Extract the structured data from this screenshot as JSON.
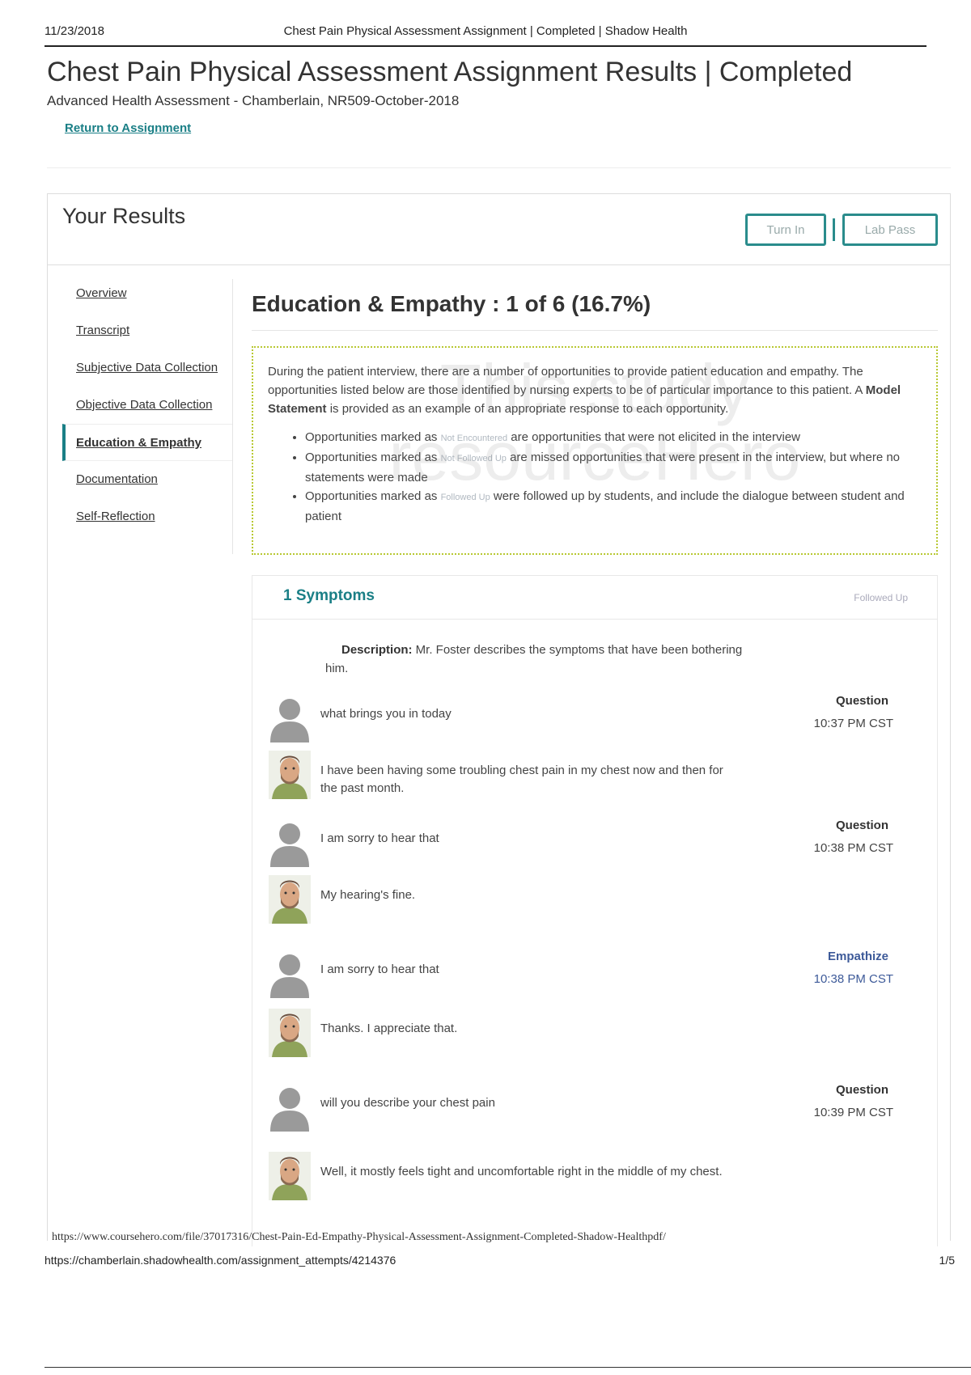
{
  "print_header": {
    "date": "11/23/2018",
    "title": "Chest Pain Physical Assessment Assignment | Completed | Shadow Health"
  },
  "page": {
    "title": "Chest Pain Physical Assessment Assignment Results | Completed",
    "course": "Advanced Health Assessment - Chamberlain, NR509-October-2018",
    "return_link": "Return to Assignment"
  },
  "results": {
    "heading": "Your Results",
    "turn_in_label": "Turn In",
    "lab_pass_label": "Lab Pass"
  },
  "sidebar": {
    "items": [
      {
        "label": "Overview"
      },
      {
        "label": "Transcript"
      },
      {
        "label": "Subjective Data Collection"
      },
      {
        "label": "Objective Data Collection"
      },
      {
        "label": "Education & Empathy"
      },
      {
        "label": "Documentation"
      },
      {
        "label": "Self-Reflection"
      }
    ],
    "active_index": 4
  },
  "section": {
    "title": "Education & Empathy : 1 of 6 (16.7%)",
    "intro_pre": "During the patient interview, there are a number of opportunities to provide patient education and empathy. The opportunities listed below are those identified by nursing experts to be of particular importance to this patient. A ",
    "intro_bold": "Model Statement",
    "intro_post": " is provided as an example of an appropriate response to each opportunity.",
    "bullets": [
      {
        "pre": "Opportunities marked as ",
        "tag": "Not Encountered",
        "post": " are opportunities that were not elicited in the interview"
      },
      {
        "pre": "Opportunities marked as ",
        "tag": "Not Followed Up",
        "post": " are missed opportunities that were present in the interview, but where no statements were made"
      },
      {
        "pre": "Opportunities marked as ",
        "tag": "Followed Up",
        "post": " were followed up by students, and include the dialogue between student and patient"
      }
    ],
    "watermark_line1": "This study",
    "watermark_line2": "resourceHero"
  },
  "symptom": {
    "name": "1 Symptoms",
    "status": "Followed Up",
    "desc_label": "Description:",
    "desc_text": " Mr. Foster describes the symptoms that have been bothering him."
  },
  "messages": [
    {
      "speaker": "student",
      "text": "what brings you in today",
      "type": "Question",
      "time": "10:37 PM CST"
    },
    {
      "speaker": "patient",
      "text": "I have been having some troubling chest pain in my chest now and then for the past month."
    },
    {
      "speaker": "student",
      "text": "I am sorry to hear that",
      "type": "Question",
      "time": "10:38 PM CST"
    },
    {
      "speaker": "patient",
      "text": "My hearing's fine."
    },
    {
      "speaker": "student",
      "text": "I am sorry to hear that",
      "type": "Empathize",
      "time": "10:38 PM CST"
    },
    {
      "speaker": "patient",
      "text": "Thanks. I appreciate that."
    },
    {
      "speaker": "student",
      "text": "will you describe your chest pain",
      "type": "Question",
      "time": "10:39 PM CST"
    },
    {
      "speaker": "patient",
      "text": "Well, it mostly feels tight and uncomfortable right in the middle of my chest."
    }
  ],
  "footer": {
    "source_url": "https://www.coursehero.com/file/37017316/Chest-Pain-Ed-Empathy-Physical-Assessment-Assignment-Completed-Shadow-Healthpdf/",
    "page_url": "https://chamberlain.shadowhealth.com/assignment_attempts/4214376",
    "page_number": "1/5"
  },
  "colors": {
    "accent": "#1a7f86",
    "empathize": "#3d5a99",
    "info_border": "#b8c832"
  }
}
